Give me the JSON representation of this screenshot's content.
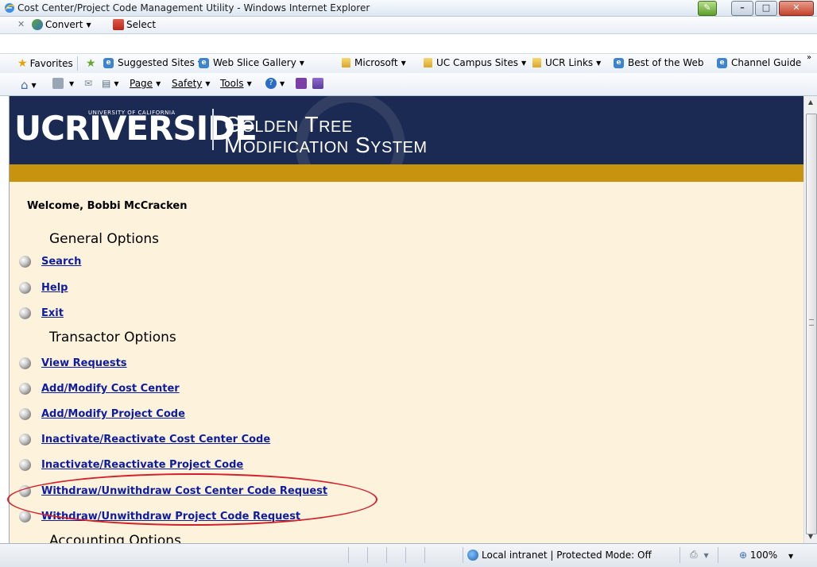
{
  "window": {
    "title": "Cost Center/Project Code Management Utility - Windows Internet Explorer"
  },
  "command_bar": {
    "convert": "Convert",
    "select": "Select"
  },
  "favorites_bar": {
    "favorites": "Favorites",
    "links": [
      "Suggested Sites",
      "Web Slice Gallery",
      "Microsoft",
      "UC Campus Sites",
      "UCR Links",
      "Best of the Web",
      "Channel Guide"
    ]
  },
  "tools_bar": {
    "page": "Page",
    "safety": "Safety",
    "tools": "Tools"
  },
  "banner": {
    "uc": "UCRIVERSIDE",
    "university": "UNIVERSITY OF CALIFORNIA",
    "line1": "Golden Tree",
    "line2": "Modification System"
  },
  "page": {
    "welcome": "Welcome, Bobbi McCracken",
    "general_heading": "General Options",
    "general_options": [
      "Search",
      "Help",
      "Exit"
    ],
    "transactor_heading": "Transactor Options",
    "transactor_options": [
      "View Requests",
      "Add/Modify Cost Center",
      "Add/Modify Project Code",
      "Inactivate/Reactivate Cost Center Code",
      "Inactivate/Reactivate Project Code",
      "Withdraw/Unwithdraw Cost Center Code Request",
      "Withdraw/Unwithdraw Project Code Request"
    ],
    "accounting_heading": "Accounting Options"
  },
  "status_bar": {
    "zone": "Local intranet | Protected Mode: Off",
    "zoom": "100%"
  },
  "colors": {
    "banner_navy": "#1b2a52",
    "gold_bar": "#c8940f",
    "cream_bg": "#fdf3dc",
    "link": "#0e1ca0",
    "highlight_red": "#d3202b"
  }
}
